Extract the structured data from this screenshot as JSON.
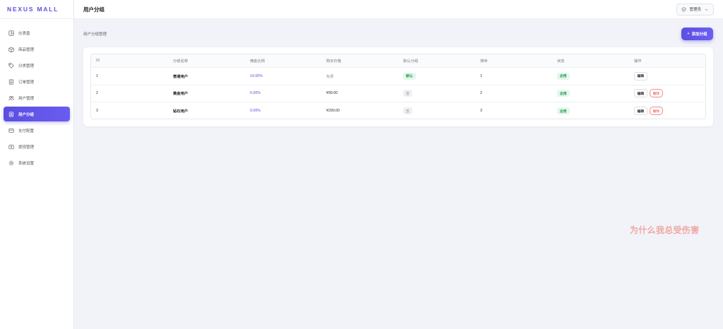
{
  "app": {
    "logo": "NEXUS MALL"
  },
  "sidebar": {
    "items": [
      {
        "label": "仪表盘",
        "icon": "dashboard-icon"
      },
      {
        "label": "商品管理",
        "icon": "box-icon"
      },
      {
        "label": "分类管理",
        "icon": "tag-icon"
      },
      {
        "label": "订单管理",
        "icon": "order-icon"
      },
      {
        "label": "用户管理",
        "icon": "users-icon"
      },
      {
        "label": "用户分组",
        "icon": "user-group-icon",
        "active": true
      },
      {
        "label": "支付配置",
        "icon": "card-icon"
      },
      {
        "label": "提现管理",
        "icon": "withdraw-icon"
      },
      {
        "label": "系统设置",
        "icon": "gear-icon"
      }
    ]
  },
  "header": {
    "title": "用户分组",
    "user": "管理员"
  },
  "main": {
    "section_label": "用户分组管理",
    "add_button": "添加分组",
    "table": {
      "columns": [
        "ID",
        "分组名称",
        "佣金比例",
        "购买价格",
        "默认分组",
        "排序",
        "状态",
        "操作"
      ],
      "rows": [
        {
          "id": "1",
          "name": "普通用户",
          "rate": "10.00%",
          "price": "免费",
          "default": "默认",
          "sort": "1",
          "status": "启用",
          "edit": "编辑",
          "delete": ""
        },
        {
          "id": "2",
          "name": "黄金用户",
          "rate": "5.00%",
          "price": "¥99.00",
          "default": "否",
          "sort": "2",
          "status": "启用",
          "edit": "编辑",
          "delete": "删除"
        },
        {
          "id": "3",
          "name": "钻石用户",
          "rate": "0.00%",
          "price": "¥299.00",
          "default": "否",
          "sort": "3",
          "status": "启用",
          "edit": "编辑",
          "delete": "删除"
        }
      ]
    }
  },
  "watermark": "为什么我总受伤害",
  "colors": {
    "accent": "#5b4fe0",
    "success": "#1a9a50",
    "danger": "#e54545",
    "background": "#f1f3f8"
  }
}
